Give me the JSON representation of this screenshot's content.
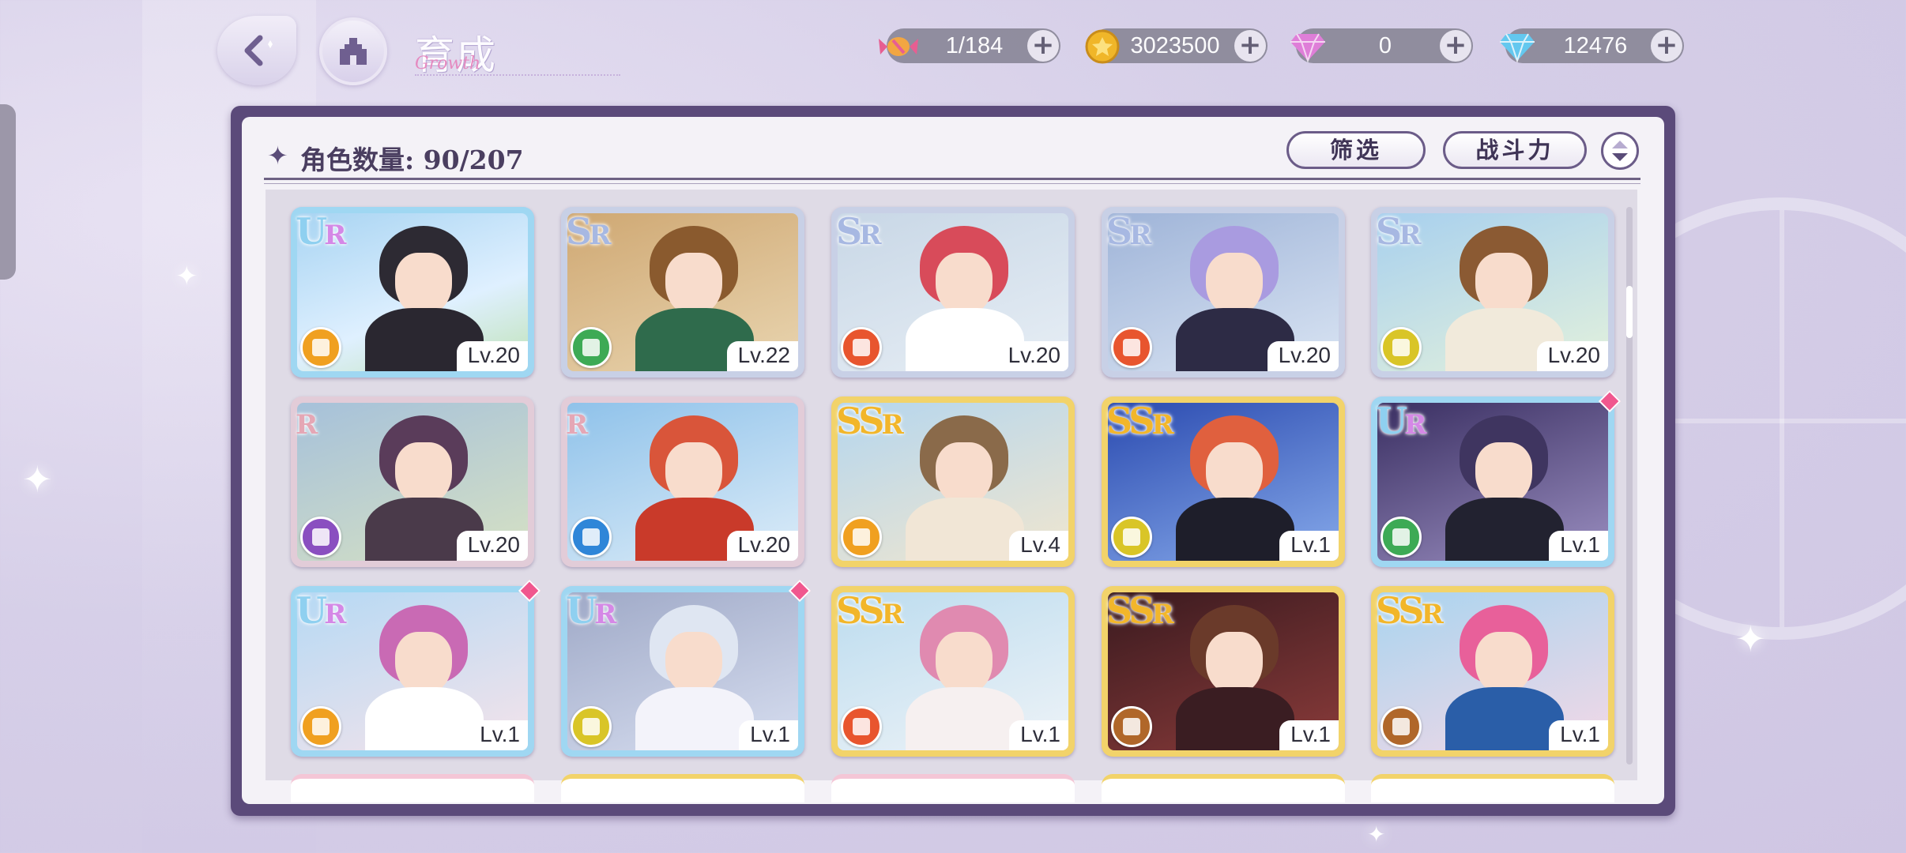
{
  "header": {
    "title": "育成",
    "subtitle": "Growth"
  },
  "currencies": [
    {
      "name": "stamina",
      "icon": "candy-icon",
      "value": "1/184"
    },
    {
      "name": "gold",
      "icon": "gold-coin-icon",
      "value": "3023500"
    },
    {
      "name": "gem",
      "icon": "pink-diamond-icon",
      "value": "0"
    },
    {
      "name": "diamond",
      "icon": "blue-diamond-icon",
      "value": "12476"
    }
  ],
  "panel": {
    "count_label": "角色数量: 90/207",
    "filter_label": "筛选",
    "sort_label": "战斗力"
  },
  "cards": [
    {
      "rarity": "UR",
      "level": "Lv.20",
      "attr_color": "#f0a020",
      "new": false
    },
    {
      "rarity": "SR",
      "level": "Lv.22",
      "attr_color": "#3daa55",
      "new": false
    },
    {
      "rarity": "SR",
      "level": "Lv.20",
      "attr_color": "#e8552e",
      "new": false
    },
    {
      "rarity": "SR",
      "level": "Lv.20",
      "attr_color": "#e8552e",
      "new": false
    },
    {
      "rarity": "SR",
      "level": "Lv.20",
      "attr_color": "#d9c527",
      "new": false
    },
    {
      "rarity": "R",
      "level": "Lv.20",
      "attr_color": "#8a4fc0",
      "new": false
    },
    {
      "rarity": "R",
      "level": "Lv.20",
      "attr_color": "#2f86d8",
      "new": false
    },
    {
      "rarity": "SSR",
      "level": "Lv.4",
      "attr_color": "#f0a020",
      "new": false
    },
    {
      "rarity": "SSR",
      "level": "Lv.1",
      "attr_color": "#d9c527",
      "new": false
    },
    {
      "rarity": "UR",
      "level": "Lv.1",
      "attr_color": "#3daa55",
      "new": true
    },
    {
      "rarity": "UR",
      "level": "Lv.1",
      "attr_color": "#f0a020",
      "new": true
    },
    {
      "rarity": "UR",
      "level": "Lv.1",
      "attr_color": "#d9c527",
      "new": true
    },
    {
      "rarity": "SSR",
      "level": "Lv.1",
      "attr_color": "#e8552e",
      "new": false
    },
    {
      "rarity": "SSR",
      "level": "Lv.1",
      "attr_color": "#b0672a",
      "new": false
    },
    {
      "rarity": "SSR",
      "level": "Lv.1",
      "attr_color": "#b0672a",
      "new": false
    }
  ]
}
